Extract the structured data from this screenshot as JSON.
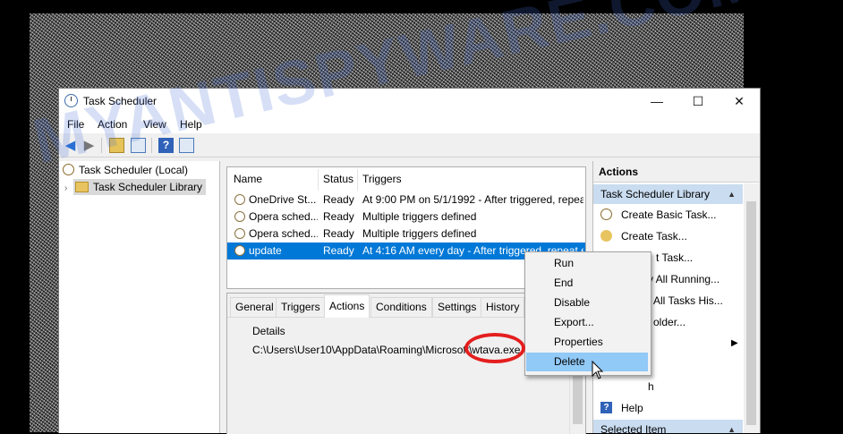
{
  "window": {
    "title": "Task Scheduler",
    "controls": [
      "—",
      "☐",
      "✕"
    ]
  },
  "menu": [
    "File",
    "Action",
    "View",
    "Help"
  ],
  "toolbar": {
    "icons": [
      "back-arrow-icon",
      "forward-arrow-icon",
      "folder-up-icon",
      "show-hide-tree-icon",
      "help-icon",
      "show-hide-action-pane-icon"
    ]
  },
  "tree": {
    "root": "Task Scheduler (Local)",
    "library": "Task Scheduler Library"
  },
  "tasks": {
    "columns": [
      "Name",
      "Status",
      "Triggers"
    ],
    "rows": [
      {
        "name": "OneDrive St...",
        "status": "Ready",
        "triggers": "At 9:00 PM on 5/1/1992 - After triggered, repea"
      },
      {
        "name": "Opera sched...",
        "status": "Ready",
        "triggers": "Multiple triggers defined"
      },
      {
        "name": "Opera sched...",
        "status": "Ready",
        "triggers": "Multiple triggers defined"
      },
      {
        "name": "update",
        "status": "Ready",
        "triggers": "At 4:16 AM every day - After triggered, repeat e"
      }
    ]
  },
  "detail_tabs": [
    "General",
    "Triggers",
    "Actions",
    "Conditions",
    "Settings",
    "History"
  ],
  "details": {
    "header": "Details",
    "path": "C:\\Users\\User10\\AppData\\Roaming\\Microsoft\\wtava.exe"
  },
  "actions_pane": {
    "title": "Actions",
    "section1": "Task Scheduler Library",
    "items": [
      "Create Basic Task...",
      "Create Task...",
      "t Task...",
      "y All Running...",
      "All Tasks His...",
      "older...",
      "",
      "",
      "h",
      "Help"
    ],
    "section2": "Selected Item"
  },
  "context_menu": [
    "Run",
    "End",
    "Disable",
    "Export...",
    "Properties",
    "Delete"
  ],
  "watermark": "MYANTISPYWARE.COM",
  "colors": {
    "selection": "#0078d7",
    "highlight": "#91c9f7",
    "ring": "#e41e1e",
    "section": "#c9dcf0"
  }
}
